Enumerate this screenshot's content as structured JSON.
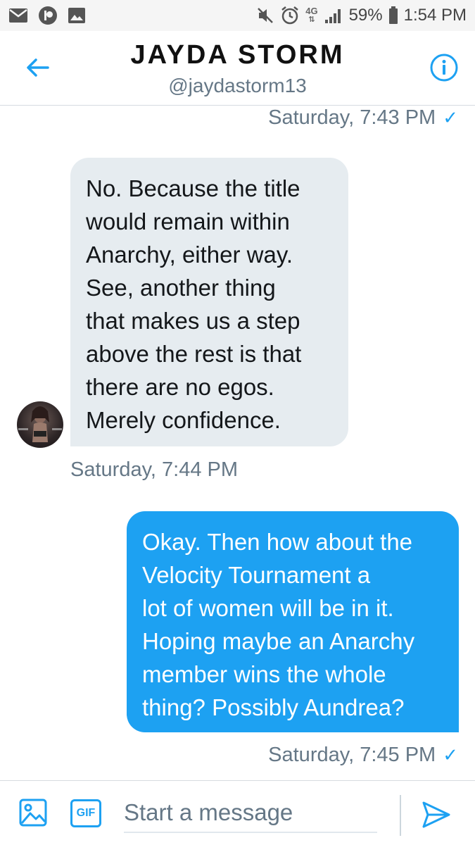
{
  "status_bar": {
    "battery": "59%",
    "time": "1:54 PM",
    "network": "4G",
    "icons": [
      "mail-icon",
      "patreon-icon",
      "image-icon",
      "mute-icon",
      "alarm-icon",
      "signal-icon",
      "battery-icon"
    ]
  },
  "header": {
    "title": "JAYDA STORM",
    "handle": "@jaydastorm13"
  },
  "messages": [
    {
      "type": "timestamp",
      "text": "Saturday, 7:43 PM",
      "read": true
    },
    {
      "type": "received",
      "lines": [
        "No. Because the title",
        "would remain within",
        "Anarchy, either way.",
        "See, another thing",
        "that makes us a step",
        "above the rest is that",
        "there are no egos.",
        "Merely confidence."
      ],
      "timestamp": "Saturday, 7:44 PM"
    },
    {
      "type": "sent",
      "lines": [
        "Okay. Then how about the",
        "Velocity Tournament a",
        "lot of women will be in it.",
        "Hoping maybe an Anarchy",
        "member wins the whole",
        "thing? Possibly Aundrea?"
      ],
      "timestamp": "Saturday, 7:45 PM",
      "read": true
    }
  ],
  "composer": {
    "placeholder": "Start a message",
    "gif_label": "GIF"
  },
  "colors": {
    "accent": "#1da1f2",
    "received_bubble": "#e6ecf0",
    "muted_text": "#657786"
  }
}
